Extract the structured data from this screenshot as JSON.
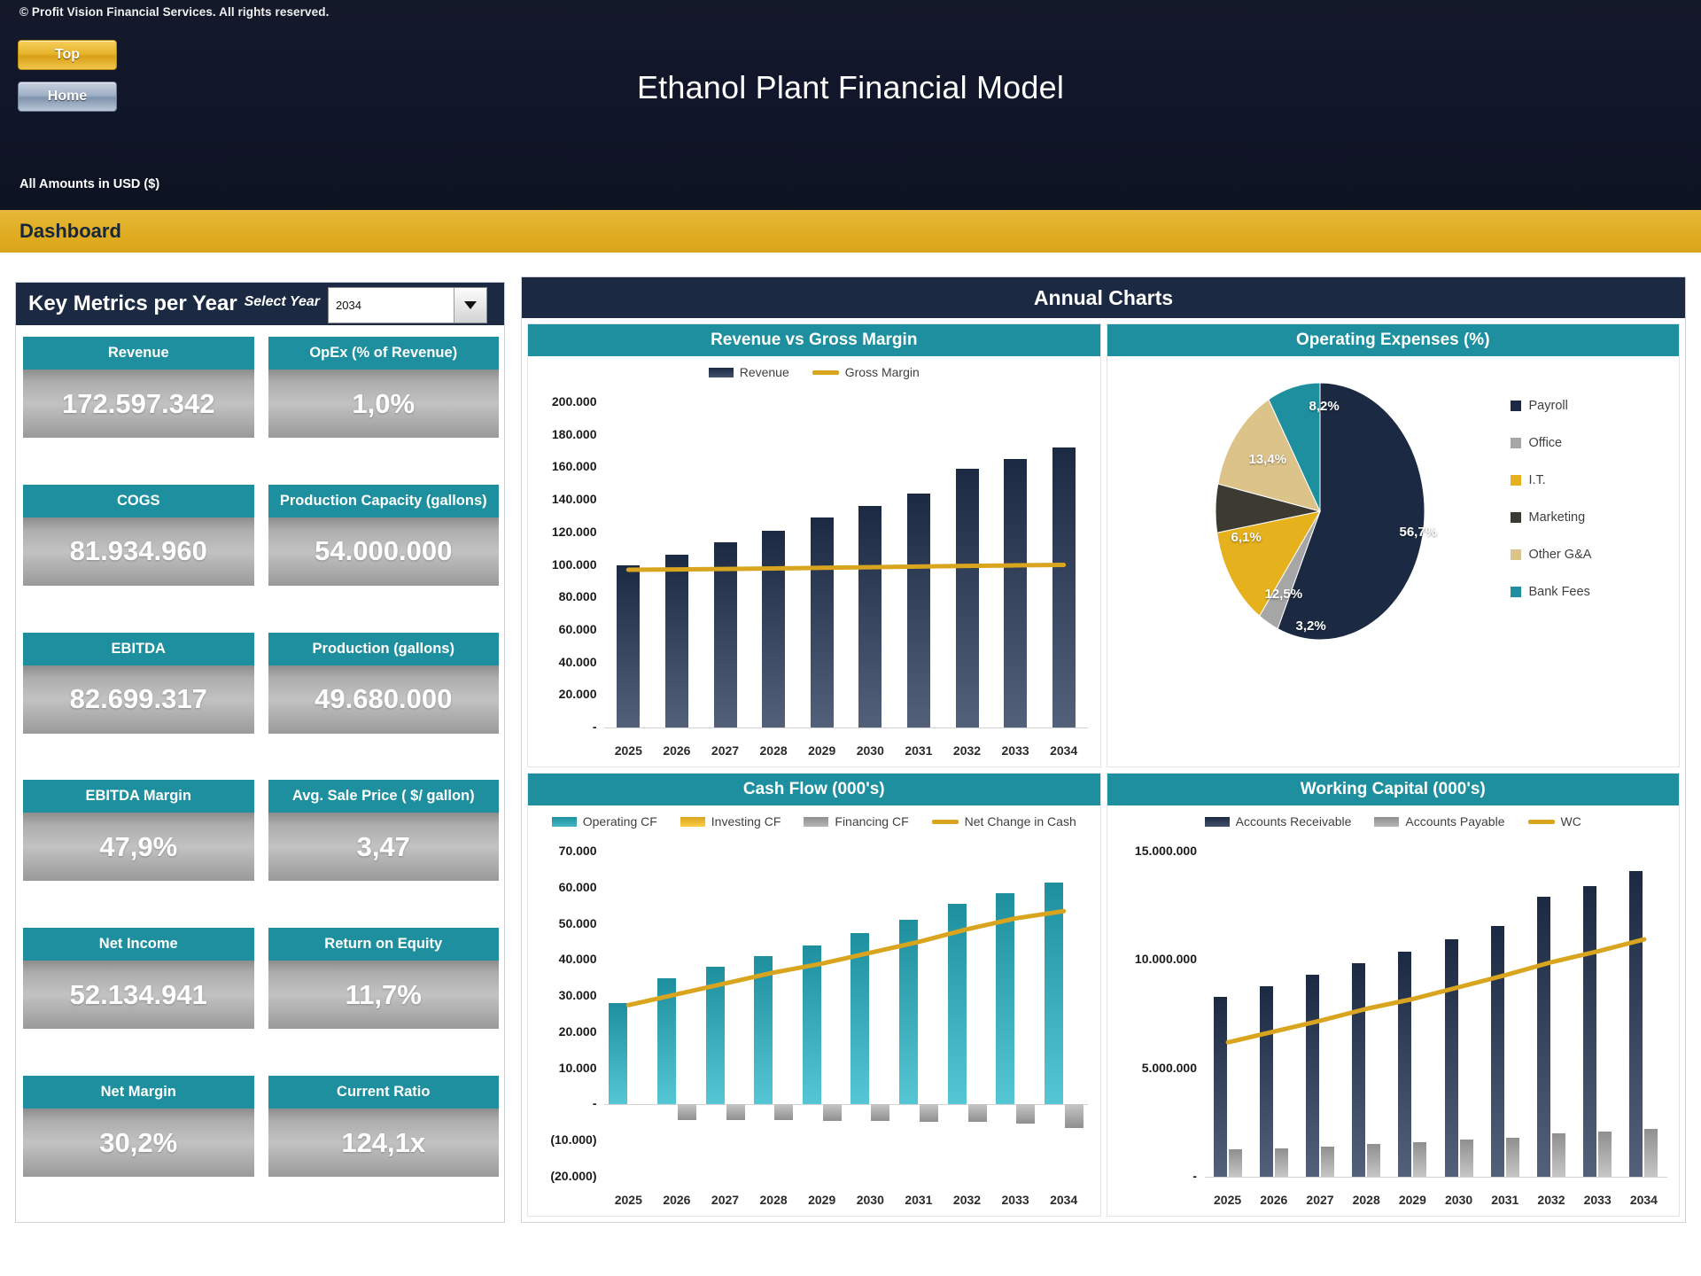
{
  "header": {
    "copyright": "© Profit Vision Financial Services. All rights reserved.",
    "top_button": "Top",
    "home_button": "Home",
    "model_title": "Ethanol Plant Financial Model",
    "amounts_note": "All Amounts in  USD ($)",
    "dashboard_label": "Dashboard"
  },
  "kpi": {
    "title": "Key Metrics per Year",
    "select_year_label": "Select Year",
    "selected_year": "2034",
    "metrics": [
      {
        "label": "Revenue",
        "value": "172.597.342"
      },
      {
        "label": "OpEx (% of Revenue)",
        "value": "1,0%"
      },
      {
        "label": "COGS",
        "value": "81.934.960"
      },
      {
        "label": "Production Capacity (gallons)",
        "value": "54.000.000"
      },
      {
        "label": "EBITDA",
        "value": "82.699.317"
      },
      {
        "label": "Production (gallons)",
        "value": "49.680.000"
      },
      {
        "label": "EBITDA Margin",
        "value": "47,9%"
      },
      {
        "label": "Avg. Sale Price ( $/ gallon)",
        "value": "3,47"
      },
      {
        "label": "Net Income",
        "value": "52.134.941"
      },
      {
        "label": "Return on Equity",
        "value": "11,7%"
      },
      {
        "label": "Net Margin",
        "value": "30,2%"
      },
      {
        "label": "Current Ratio",
        "value": "124,1x"
      }
    ]
  },
  "charts_panel": {
    "title": "Annual Charts"
  },
  "colors": {
    "navy": "#1b2a42",
    "teal": "#1d8f9e",
    "gold": "#d9a51f",
    "grey": "#8f8f8f",
    "dark_brown": "#3d3a32",
    "sand": "#dcc38a",
    "bar_navy_top": "#16203a",
    "bar_navy_bottom": "#4c5f7e"
  },
  "chart_data": [
    {
      "type": "bar",
      "title": "Revenue vs Gross Margin",
      "categories": [
        "2025",
        "2026",
        "2027",
        "2028",
        "2029",
        "2030",
        "2031",
        "2032",
        "2033",
        "2034"
      ],
      "series": [
        {
          "name": "Revenue",
          "kind": "bar",
          "color": "#1b2a42",
          "values": [
            100000,
            106000,
            114000,
            121000,
            129000,
            136000,
            144000,
            159000,
            165000,
            172000
          ]
        },
        {
          "name": "Gross Margin",
          "kind": "line",
          "color": "#d9a51f",
          "values": [
            97000,
            97200,
            97500,
            97800,
            98200,
            98600,
            99000,
            99400,
            99700,
            100000
          ]
        }
      ],
      "ylim": [
        0,
        200000
      ],
      "yticks": [
        "200.000",
        "180.000",
        "160.000",
        "140.000",
        "120.000",
        "100.000",
        "80.000",
        "60.000",
        "40.000",
        "20.000",
        "-"
      ],
      "xlabel": "",
      "ylabel": "",
      "grid": false,
      "legend_position": "top"
    },
    {
      "type": "pie",
      "title": "Operating Expenses (%)",
      "labels": [
        "Payroll",
        "Office",
        "I.T.",
        "Marketing",
        "Other G&A",
        "Bank Fees"
      ],
      "values": [
        56.7,
        3.2,
        12.5,
        6.1,
        13.4,
        8.2
      ],
      "value_labels": [
        "56,7%",
        "3,2%",
        "12,5%",
        "6,1%",
        "13,4%",
        "8,2%"
      ],
      "colors": [
        "#1b2a42",
        "#a6a6a6",
        "#e5b11d",
        "#3d3a32",
        "#dcc38a",
        "#1d8f9e"
      ],
      "legend_position": "right"
    },
    {
      "type": "bar",
      "title": "Cash Flow (000's)",
      "categories": [
        "2025",
        "2026",
        "2027",
        "2028",
        "2029",
        "2030",
        "2031",
        "2032",
        "2033",
        "2034"
      ],
      "series": [
        {
          "name": "Operating CF",
          "kind": "bar",
          "color": "#1d8f9e",
          "values": [
            28000,
            35000,
            38000,
            41000,
            44000,
            47500,
            51000,
            55500,
            58500,
            61500
          ]
        },
        {
          "name": "Investing CF",
          "kind": "bar",
          "color": "#d9a51f",
          "values": [
            0,
            0,
            0,
            0,
            0,
            0,
            0,
            0,
            0,
            0
          ]
        },
        {
          "name": "Financing CF",
          "kind": "bar",
          "color": "#8f8f8f",
          "values": [
            0,
            -4200,
            -4300,
            -4400,
            -4500,
            -4600,
            -4700,
            -4800,
            -5200,
            -6500
          ]
        },
        {
          "name": "Net Change in Cash",
          "kind": "line",
          "color": "#d9a51f",
          "values": [
            27500,
            30500,
            33500,
            36500,
            39000,
            42000,
            45000,
            48500,
            51500,
            53500
          ]
        }
      ],
      "ylim": [
        -20000,
        70000
      ],
      "yticks": [
        "70.000",
        "60.000",
        "50.000",
        "40.000",
        "30.000",
        "20.000",
        "10.000",
        "-",
        "(10.000)",
        "(20.000)"
      ],
      "xlabel": "",
      "ylabel": "",
      "grid": false,
      "legend_position": "top"
    },
    {
      "type": "bar",
      "title": "Working Capital (000's)",
      "categories": [
        "2025",
        "2026",
        "2027",
        "2028",
        "2029",
        "2030",
        "2031",
        "2032",
        "2033",
        "2034"
      ],
      "series": [
        {
          "name": "Accounts Receivable",
          "kind": "bar",
          "color": "#1b2a42",
          "values": [
            8300000,
            8800000,
            9300000,
            9850000,
            10400000,
            10950000,
            11550000,
            12900000,
            13400000,
            14100000
          ]
        },
        {
          "name": "Accounts Payable",
          "kind": "bar",
          "color": "#8f8f8f",
          "values": [
            1250000,
            1300000,
            1400000,
            1500000,
            1600000,
            1700000,
            1800000,
            2000000,
            2100000,
            2200000
          ]
        },
        {
          "name": "WC",
          "kind": "line",
          "color": "#d9a51f",
          "values": [
            6200000,
            6700000,
            7200000,
            7750000,
            8200000,
            8750000,
            9300000,
            9900000,
            10400000,
            10950000
          ]
        }
      ],
      "ylim": [
        0,
        15000000
      ],
      "yticks": [
        "15.000.000",
        "10.000.000",
        "5.000.000",
        "-"
      ],
      "xlabel": "",
      "ylabel": "",
      "grid": false,
      "legend_position": "top"
    }
  ]
}
